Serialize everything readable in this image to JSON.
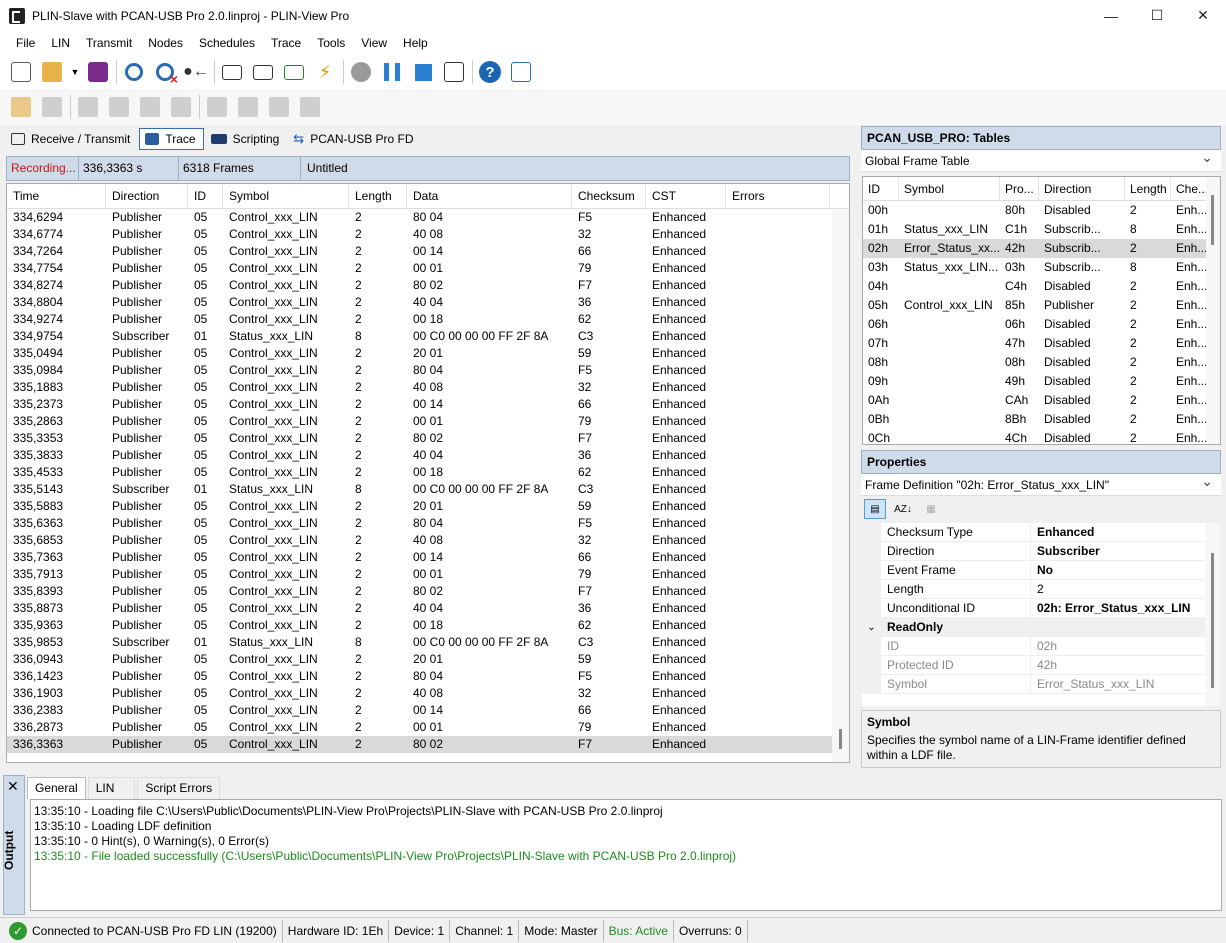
{
  "window": {
    "title": "PLIN-Slave with PCAN-USB Pro 2.0.linproj - PLIN-View Pro",
    "minimize": "—",
    "maximize": "☐",
    "close": "✕"
  },
  "menu": [
    "File",
    "LIN",
    "Transmit",
    "Nodes",
    "Schedules",
    "Trace",
    "Tools",
    "View",
    "Help"
  ],
  "tabs": [
    {
      "label": "Receive / Transmit",
      "icon": "monitor-icon"
    },
    {
      "label": "Trace",
      "icon": "trace-icon"
    },
    {
      "label": "Scripting",
      "icon": "net-icon"
    },
    {
      "label": "PCAN-USB Pro FD",
      "icon": "usb-icon"
    }
  ],
  "trace_status": {
    "recording": "Recording...",
    "time": "336,3363 s",
    "frames": "6318 Frames",
    "name": "Untitled"
  },
  "trace": {
    "columns": [
      "Time",
      "Direction",
      "ID",
      "Symbol",
      "Length",
      "Data",
      "Checksum",
      "CST",
      "Errors"
    ],
    "rows": [
      [
        "334,6294",
        "Publisher",
        "05",
        "Control_xxx_LIN",
        "2",
        "80 04",
        "F5",
        "Enhanced",
        ""
      ],
      [
        "334,6774",
        "Publisher",
        "05",
        "Control_xxx_LIN",
        "2",
        "40 08",
        "32",
        "Enhanced",
        ""
      ],
      [
        "334,7264",
        "Publisher",
        "05",
        "Control_xxx_LIN",
        "2",
        "00 14",
        "66",
        "Enhanced",
        ""
      ],
      [
        "334,7754",
        "Publisher",
        "05",
        "Control_xxx_LIN",
        "2",
        "00 01",
        "79",
        "Enhanced",
        ""
      ],
      [
        "334,8274",
        "Publisher",
        "05",
        "Control_xxx_LIN",
        "2",
        "80 02",
        "F7",
        "Enhanced",
        ""
      ],
      [
        "334,8804",
        "Publisher",
        "05",
        "Control_xxx_LIN",
        "2",
        "40 04",
        "36",
        "Enhanced",
        ""
      ],
      [
        "334,9274",
        "Publisher",
        "05",
        "Control_xxx_LIN",
        "2",
        "00 18",
        "62",
        "Enhanced",
        ""
      ],
      [
        "334,9754",
        "Subscriber",
        "01",
        "Status_xxx_LIN",
        "8",
        "00 C0 00 00 00 FF 2F 8A",
        "C3",
        "Enhanced",
        ""
      ],
      [
        "335,0494",
        "Publisher",
        "05",
        "Control_xxx_LIN",
        "2",
        "20 01",
        "59",
        "Enhanced",
        ""
      ],
      [
        "335,0984",
        "Publisher",
        "05",
        "Control_xxx_LIN",
        "2",
        "80 04",
        "F5",
        "Enhanced",
        ""
      ],
      [
        "335,1883",
        "Publisher",
        "05",
        "Control_xxx_LIN",
        "2",
        "40 08",
        "32",
        "Enhanced",
        ""
      ],
      [
        "335,2373",
        "Publisher",
        "05",
        "Control_xxx_LIN",
        "2",
        "00 14",
        "66",
        "Enhanced",
        ""
      ],
      [
        "335,2863",
        "Publisher",
        "05",
        "Control_xxx_LIN",
        "2",
        "00 01",
        "79",
        "Enhanced",
        ""
      ],
      [
        "335,3353",
        "Publisher",
        "05",
        "Control_xxx_LIN",
        "2",
        "80 02",
        "F7",
        "Enhanced",
        ""
      ],
      [
        "335,3833",
        "Publisher",
        "05",
        "Control_xxx_LIN",
        "2",
        "40 04",
        "36",
        "Enhanced",
        ""
      ],
      [
        "335,4533",
        "Publisher",
        "05",
        "Control_xxx_LIN",
        "2",
        "00 18",
        "62",
        "Enhanced",
        ""
      ],
      [
        "335,5143",
        "Subscriber",
        "01",
        "Status_xxx_LIN",
        "8",
        "00 C0 00 00 00 FF 2F 8A",
        "C3",
        "Enhanced",
        ""
      ],
      [
        "335,5883",
        "Publisher",
        "05",
        "Control_xxx_LIN",
        "2",
        "20 01",
        "59",
        "Enhanced",
        ""
      ],
      [
        "335,6363",
        "Publisher",
        "05",
        "Control_xxx_LIN",
        "2",
        "80 04",
        "F5",
        "Enhanced",
        ""
      ],
      [
        "335,6853",
        "Publisher",
        "05",
        "Control_xxx_LIN",
        "2",
        "40 08",
        "32",
        "Enhanced",
        ""
      ],
      [
        "335,7363",
        "Publisher",
        "05",
        "Control_xxx_LIN",
        "2",
        "00 14",
        "66",
        "Enhanced",
        ""
      ],
      [
        "335,7913",
        "Publisher",
        "05",
        "Control_xxx_LIN",
        "2",
        "00 01",
        "79",
        "Enhanced",
        ""
      ],
      [
        "335,8393",
        "Publisher",
        "05",
        "Control_xxx_LIN",
        "2",
        "80 02",
        "F7",
        "Enhanced",
        ""
      ],
      [
        "335,8873",
        "Publisher",
        "05",
        "Control_xxx_LIN",
        "2",
        "40 04",
        "36",
        "Enhanced",
        ""
      ],
      [
        "335,9363",
        "Publisher",
        "05",
        "Control_xxx_LIN",
        "2",
        "00 18",
        "62",
        "Enhanced",
        ""
      ],
      [
        "335,9853",
        "Subscriber",
        "01",
        "Status_xxx_LIN",
        "8",
        "00 C0 00 00 00 FF 2F 8A",
        "C3",
        "Enhanced",
        ""
      ],
      [
        "336,0943",
        "Publisher",
        "05",
        "Control_xxx_LIN",
        "2",
        "20 01",
        "59",
        "Enhanced",
        ""
      ],
      [
        "336,1423",
        "Publisher",
        "05",
        "Control_xxx_LIN",
        "2",
        "80 04",
        "F5",
        "Enhanced",
        ""
      ],
      [
        "336,1903",
        "Publisher",
        "05",
        "Control_xxx_LIN",
        "2",
        "40 08",
        "32",
        "Enhanced",
        ""
      ],
      [
        "336,2383",
        "Publisher",
        "05",
        "Control_xxx_LIN",
        "2",
        "00 14",
        "66",
        "Enhanced",
        ""
      ],
      [
        "336,2873",
        "Publisher",
        "05",
        "Control_xxx_LIN",
        "2",
        "00 01",
        "79",
        "Enhanced",
        ""
      ],
      [
        "336,3363",
        "Publisher",
        "05",
        "Control_xxx_LIN",
        "2",
        "80 02",
        "F7",
        "Enhanced",
        ""
      ]
    ],
    "selected_index": 31
  },
  "tables_panel": {
    "title": "PCAN_USB_PRO: Tables",
    "combo": "Global Frame Table",
    "columns": [
      "ID",
      "Symbol",
      "Pro...",
      "Direction",
      "Length",
      "Che..."
    ],
    "rows": [
      [
        "00h",
        "",
        "80h",
        "Disabled",
        "2",
        "Enh..."
      ],
      [
        "01h",
        "Status_xxx_LIN",
        "C1h",
        "Subscrib...",
        "8",
        "Enh..."
      ],
      [
        "02h",
        "Error_Status_xx...",
        "42h",
        "Subscrib...",
        "2",
        "Enh..."
      ],
      [
        "03h",
        "Status_xxx_LIN...",
        "03h",
        "Subscrib...",
        "8",
        "Enh..."
      ],
      [
        "04h",
        "",
        "C4h",
        "Disabled",
        "2",
        "Enh..."
      ],
      [
        "05h",
        "Control_xxx_LIN",
        "85h",
        "Publisher",
        "2",
        "Enh..."
      ],
      [
        "06h",
        "",
        "06h",
        "Disabled",
        "2",
        "Enh..."
      ],
      [
        "07h",
        "",
        "47h",
        "Disabled",
        "2",
        "Enh..."
      ],
      [
        "08h",
        "",
        "08h",
        "Disabled",
        "2",
        "Enh..."
      ],
      [
        "09h",
        "",
        "49h",
        "Disabled",
        "2",
        "Enh..."
      ],
      [
        "0Ah",
        "",
        "CAh",
        "Disabled",
        "2",
        "Enh..."
      ],
      [
        "0Bh",
        "",
        "8Bh",
        "Disabled",
        "2",
        "Enh..."
      ],
      [
        "0Ch",
        "",
        "4Ch",
        "Disabled",
        "2",
        "Enh..."
      ]
    ],
    "selected_index": 2
  },
  "properties": {
    "title": "Properties",
    "combo": "Frame Definition \"02h: Error_Status_xxx_LIN\"",
    "rows": [
      {
        "name": "Checksum Type",
        "value": "Enhanced",
        "bold": true
      },
      {
        "name": "Direction",
        "value": "Subscriber",
        "bold": true
      },
      {
        "name": "Event Frame",
        "value": "No",
        "bold": true
      },
      {
        "name": "Length",
        "value": "2",
        "bold": false
      },
      {
        "name": "Unconditional ID",
        "value": "02h: Error_Status_xxx_LIN",
        "bold": true
      }
    ],
    "category": "ReadOnly",
    "readonly_rows": [
      {
        "name": "ID",
        "value": "02h"
      },
      {
        "name": "Protected ID",
        "value": "42h"
      },
      {
        "name": "Symbol",
        "value": "Error_Status_xxx_LIN"
      }
    ],
    "desc_title": "Symbol",
    "desc_text": "Specifies the symbol name of a LIN-Frame identifier defined within a LDF file."
  },
  "output": {
    "side_label": "Output",
    "close": "✕",
    "tabs": [
      "General",
      "LIN",
      "Script Errors"
    ],
    "lines": [
      {
        "text": "13:35:10 - Loading file C:\\Users\\Public\\Documents\\PLIN-View Pro\\Projects\\PLIN-Slave with PCAN-USB Pro 2.0.linproj",
        "ok": false
      },
      {
        "text": "13:35:10 - Loading LDF definition",
        "ok": false
      },
      {
        "text": "13:35:10 - 0 Hint(s), 0 Warning(s), 0 Error(s)",
        "ok": false
      },
      {
        "text": "13:35:10 - File loaded successfully (C:\\Users\\Public\\Documents\\PLIN-View Pro\\Projects\\PLIN-Slave with PCAN-USB Pro 2.0.linproj)",
        "ok": true
      }
    ]
  },
  "status": {
    "connected": "Connected to PCAN-USB Pro FD LIN (19200)",
    "hardware": "Hardware ID: 1Eh",
    "device": "Device: 1",
    "channel": "Channel: 1",
    "mode": "Mode: Master",
    "bus": "Bus: Active",
    "overruns": "Overruns: 0"
  },
  "colors": {
    "accent_panel": "#cfdbe8",
    "recording": "#d01010",
    "success": "#1d8a1d",
    "selection": "#d9d9d9"
  }
}
